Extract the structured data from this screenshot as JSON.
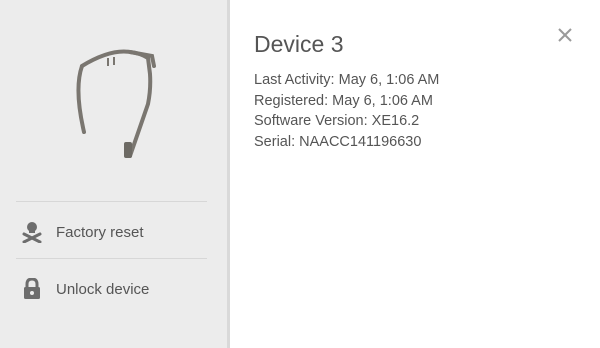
{
  "sidebar": {
    "device_image_icon": "glass-frame-icon",
    "actions": [
      {
        "label": "Factory reset",
        "icon": "skull-crossbones-icon"
      },
      {
        "label": "Unlock device",
        "icon": "lock-icon"
      }
    ]
  },
  "device": {
    "name": "Device 3",
    "details": [
      "Last Activity: May 6, 1:06 AM",
      "Registered: May 6, 1:06 AM",
      "Software Version: XE16.2",
      "Serial: NAACC141196630"
    ]
  },
  "close_icon": "close-icon",
  "colors": {
    "sidebar_bg": "#ececec",
    "text": "#555555",
    "icon": "#6d6d6d"
  }
}
